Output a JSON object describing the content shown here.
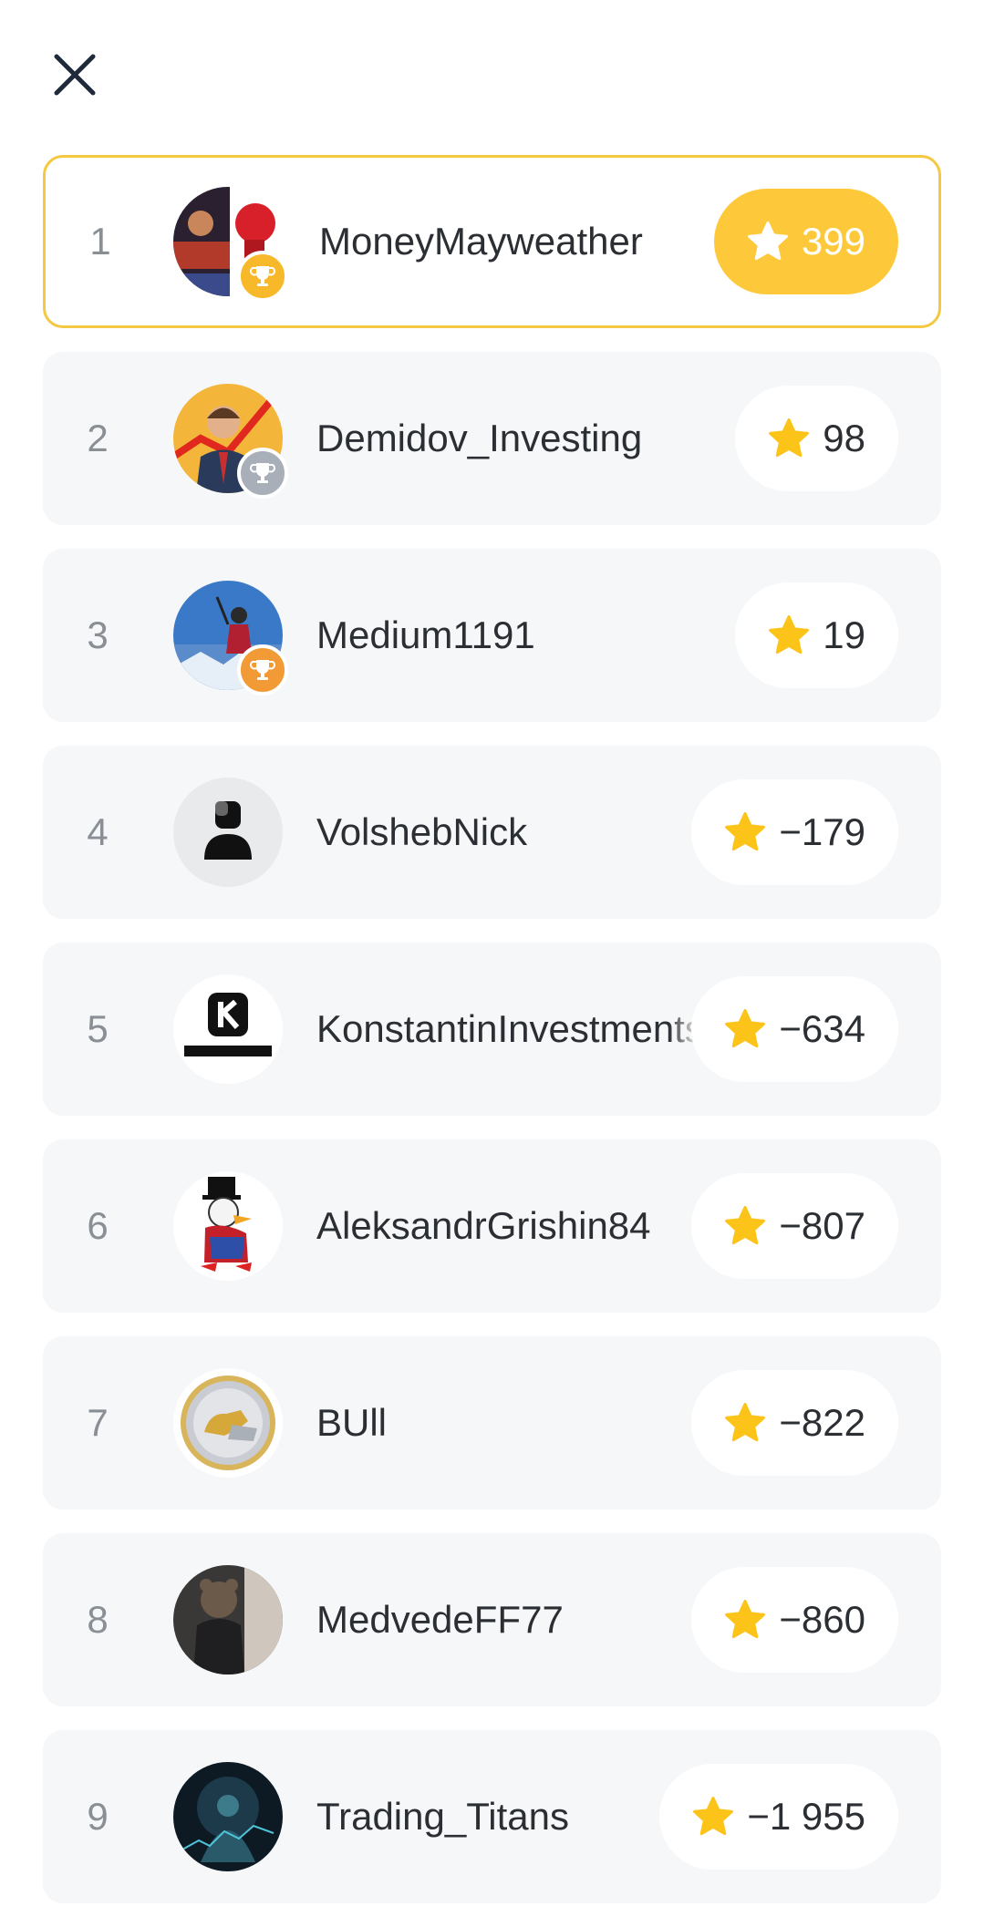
{
  "colors": {
    "accent": "#fdc93a",
    "highlight_border": "#f5c842",
    "row_bg": "#f6f7f8",
    "star": "#fcc419",
    "gold": "#f7b92a",
    "silver": "#a8afb8",
    "bronze": "#f29a36"
  },
  "icons": {
    "close": "close-icon",
    "star": "star-icon",
    "trophy": "trophy-icon"
  },
  "leaderboard": [
    {
      "rank": "1",
      "name": "MoneyMayweather",
      "score": "399",
      "trophy": "gold"
    },
    {
      "rank": "2",
      "name": "Demidov_Investing",
      "score": "98",
      "trophy": "silver"
    },
    {
      "rank": "3",
      "name": "Medium1191",
      "score": "19",
      "trophy": "bronze"
    },
    {
      "rank": "4",
      "name": "VolshebNick",
      "score": "−179",
      "trophy": ""
    },
    {
      "rank": "5",
      "name": "KonstantinInvestments",
      "score": "−634",
      "trophy": ""
    },
    {
      "rank": "6",
      "name": "AleksandrGrishin84",
      "score": "−807",
      "trophy": ""
    },
    {
      "rank": "7",
      "name": "BUll",
      "score": "−822",
      "trophy": ""
    },
    {
      "rank": "8",
      "name": "MedvedeFF77",
      "score": "−860",
      "trophy": ""
    },
    {
      "rank": "9",
      "name": "Trading_Titans",
      "score": "−1 955",
      "trophy": ""
    }
  ]
}
